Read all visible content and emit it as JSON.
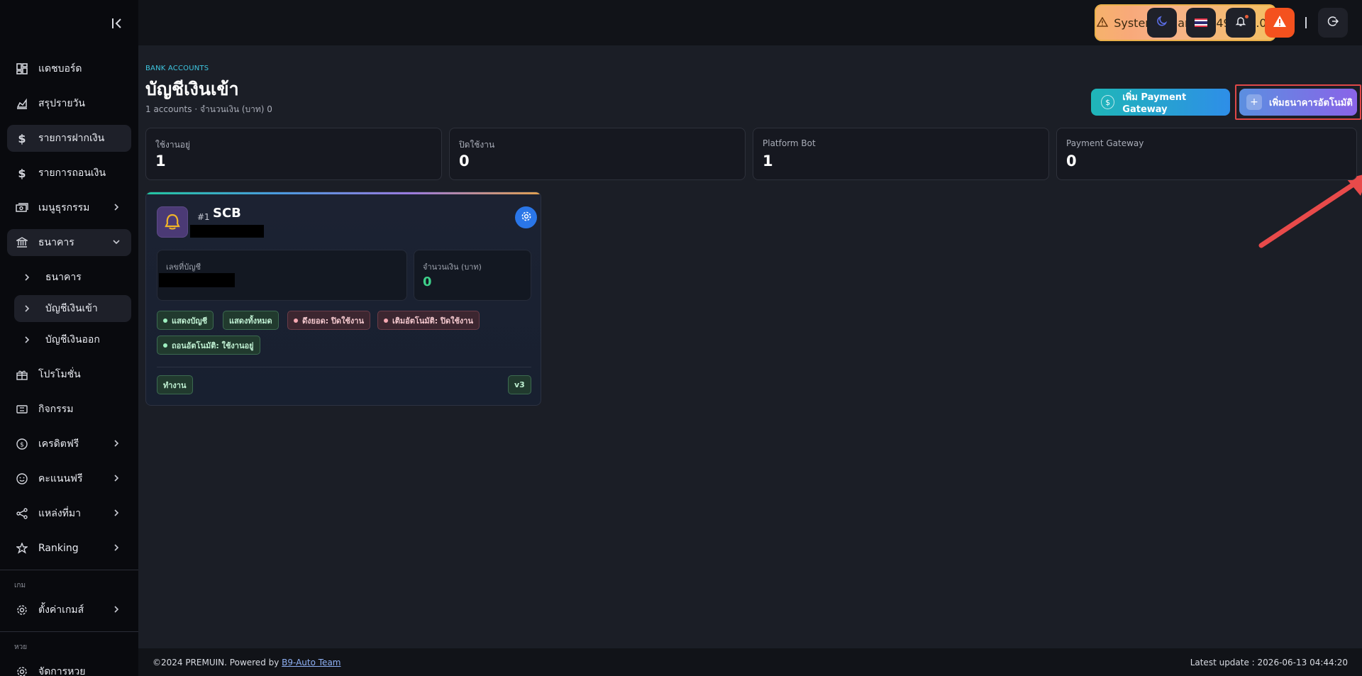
{
  "sidebar": {
    "collapse_icon": "collapse-left-icon",
    "items": [
      {
        "label": "แดชบอร์ด",
        "icon": "dashboard-icon"
      },
      {
        "label": "สรุปรายวัน",
        "icon": "chart-area-icon"
      },
      {
        "label": "รายการฝากเงิน",
        "icon": "dollar-icon"
      },
      {
        "label": "รายการถอนเงิน",
        "icon": "dollar-icon"
      },
      {
        "label": "เมนูธุรกรรม",
        "icon": "money-icon"
      },
      {
        "label": "ธนาคาร",
        "icon": "bank-icon"
      },
      {
        "label": "โปรโมชั่น",
        "icon": "gift-icon"
      },
      {
        "label": "กิจกรรม",
        "icon": "ticket-icon"
      },
      {
        "label": "เครดิตฟรี",
        "icon": "coin-icon"
      },
      {
        "label": "คะแนนฟรี",
        "icon": "smile-icon"
      },
      {
        "label": "แหล่งที่มา",
        "icon": "share-icon"
      },
      {
        "label": "Ranking",
        "icon": "star-icon"
      }
    ],
    "bank_sub": [
      {
        "label": "ธนาคาร"
      },
      {
        "label": "บัญชีเงินเข้า"
      },
      {
        "label": "บัญชีเงินออก"
      }
    ],
    "section_game": "เกม",
    "game_item": {
      "label": "ตั้งค่าเกมส์",
      "icon": "gear-icon"
    },
    "section_lotto": "หวย",
    "lotto_item": {
      "label": "จัดการหวย",
      "icon": "gear-icon"
    }
  },
  "topbar": {
    "balance_label": "System Balance : 49,800.00",
    "separator": "|"
  },
  "page": {
    "kicker": "BANK ACCOUNTS",
    "title": "บัญชีเงินเข้า",
    "subtitle": "1 accounts · จำนวนเงิน (บาท) 0",
    "btn_payment_gateway": "เพิ่ม Payment Gateway",
    "btn_add_auto_bank": "เพิ่มธนาคารอัตโนมัติ"
  },
  "stats": [
    {
      "label": "ใช้งานอยู่",
      "value": "1"
    },
    {
      "label": "ปิดใช้งาน",
      "value": "0"
    },
    {
      "label": "Platform Bot",
      "value": "1"
    },
    {
      "label": "Payment Gateway",
      "value": "0"
    }
  ],
  "account_card": {
    "number": "#1",
    "bank_name": "SCB",
    "account_no_label": "เลขที่บัญชี",
    "amount_label": "จำนวนเงิน (บาท)",
    "amount_value": "0",
    "tags": [
      {
        "label": "แสดงบัญชี",
        "type": "g",
        "dot": true
      },
      {
        "label": "แสดงทั้งหมด",
        "type": "g",
        "dot": false
      },
      {
        "label": "ดึงยอด: ปิดใช้งาน",
        "type": "r",
        "dot": true
      },
      {
        "label": "เติมอัตโนมัติ: ปิดใช้งาน",
        "type": "r",
        "dot": true
      },
      {
        "label": "ถอนอัตโนมัติ: ใช้งานอยู่",
        "type": "g",
        "dot": true
      }
    ],
    "status": "ทำงาน",
    "version": "v3"
  },
  "footer": {
    "copyright": "©2024 PREMUIN. Powered by ",
    "link": "B9-Auto Team",
    "latest_update": "Latest update : 2026-06-13 04:44:20"
  },
  "colors": {
    "accent_teal": "#1fb6b8",
    "accent_purple": "#8a63e8",
    "success": "#3ed08a",
    "danger": "#e04848",
    "warning": "#f3c063"
  }
}
